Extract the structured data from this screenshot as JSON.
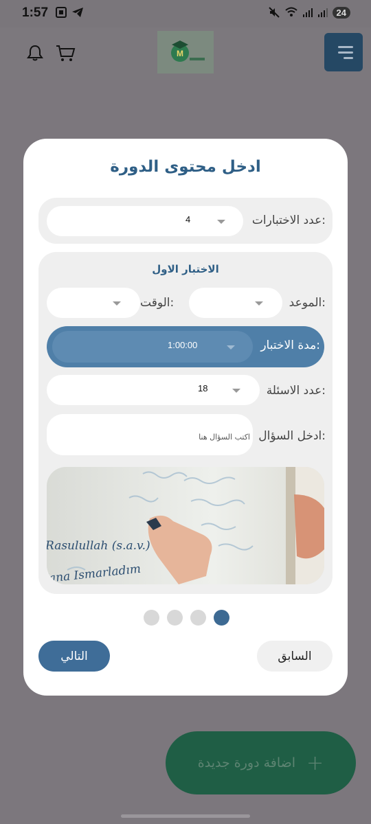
{
  "status": {
    "time": "1:57",
    "battery": "24"
  },
  "modal": {
    "title": "ادخل محتوى الدورة",
    "exams_count": {
      "label": "عدد الاختبارات:",
      "value": "4"
    },
    "exam_section": {
      "heading": "الاختبار الاول",
      "appointment_label": "الموعد:",
      "time_label": "الوقت:",
      "duration": {
        "label": "مدة الاختبار:",
        "value": "1:00:00"
      },
      "questions_count": {
        "label": "عدد الاسئلة:",
        "value": "18"
      },
      "question": {
        "label": "ادخل السؤال:",
        "placeholder": "اكتب السؤال هنا"
      },
      "board_texts": [
        "Rasulullah (s.a.v.)",
        "Jana Ismarladım"
      ]
    },
    "pager": {
      "pages": 4,
      "active_index": 3
    },
    "next_label": "التالي",
    "prev_label": "السابق"
  },
  "fab": {
    "label": "اضافة دورة جديدة"
  },
  "colors": {
    "primary": "#3f6d98",
    "accent": "#1f5e45",
    "title": "#2f5f86"
  }
}
